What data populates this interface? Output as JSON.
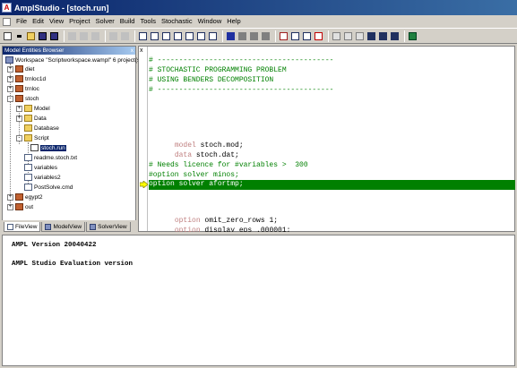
{
  "window": {
    "title": "AmplStudio - [stoch.run]"
  },
  "menu": [
    "File",
    "Edit",
    "View",
    "Project",
    "Solver",
    "Build",
    "Tools",
    "Stochastic",
    "Window",
    "Help"
  ],
  "left_panel": {
    "header": "Model Entities Browser",
    "close": "x",
    "workspace_label": "Workspace \"Scriptworkspace.wampl\" 6 project(s)",
    "tree": [
      {
        "label": "diet",
        "expander": "+"
      },
      {
        "label": "trnloc1d",
        "expander": "+"
      },
      {
        "label": "trnloc",
        "expander": "+"
      },
      {
        "label": "stoch",
        "expander": "-"
      },
      {
        "label": "Model",
        "expander": "+"
      },
      {
        "label": "Data",
        "expander": "+"
      },
      {
        "label": "Database"
      },
      {
        "label": "Script",
        "expander": "-"
      },
      {
        "label": "stoch.run"
      },
      {
        "label": "readme.stoch.txt"
      },
      {
        "label": "variables"
      },
      {
        "label": "variables2"
      },
      {
        "label": "PostSolve.cmd"
      },
      {
        "label": "egypt2",
        "expander": "+"
      },
      {
        "label": "out",
        "expander": "+"
      }
    ],
    "tabs": [
      "FileView",
      "ModelView",
      "SolverView"
    ]
  },
  "editor": {
    "margin_mark": "x",
    "lines": [
      "# -----------------------------------------",
      "# STOCHASTIC PROGRAMMING PROBLEM",
      "# USING BENDERS DECOMPOSITION",
      "# -----------------------------------------",
      "model stoch.mod;",
      "data stoch.dat;",
      "# Needs licence for #variables >  300",
      "#option solver minos;",
      "option solver afortmp;",
      "option omit_zero_rows 1;",
      "option display_eps .000001;"
    ],
    "highlight_color": "#008000",
    "comment_color": "#008000",
    "keyword_color": "#c08080"
  },
  "output": {
    "lines": [
      "AMPL Version 20040422",
      "AMPL Studio Evaluation version"
    ]
  }
}
